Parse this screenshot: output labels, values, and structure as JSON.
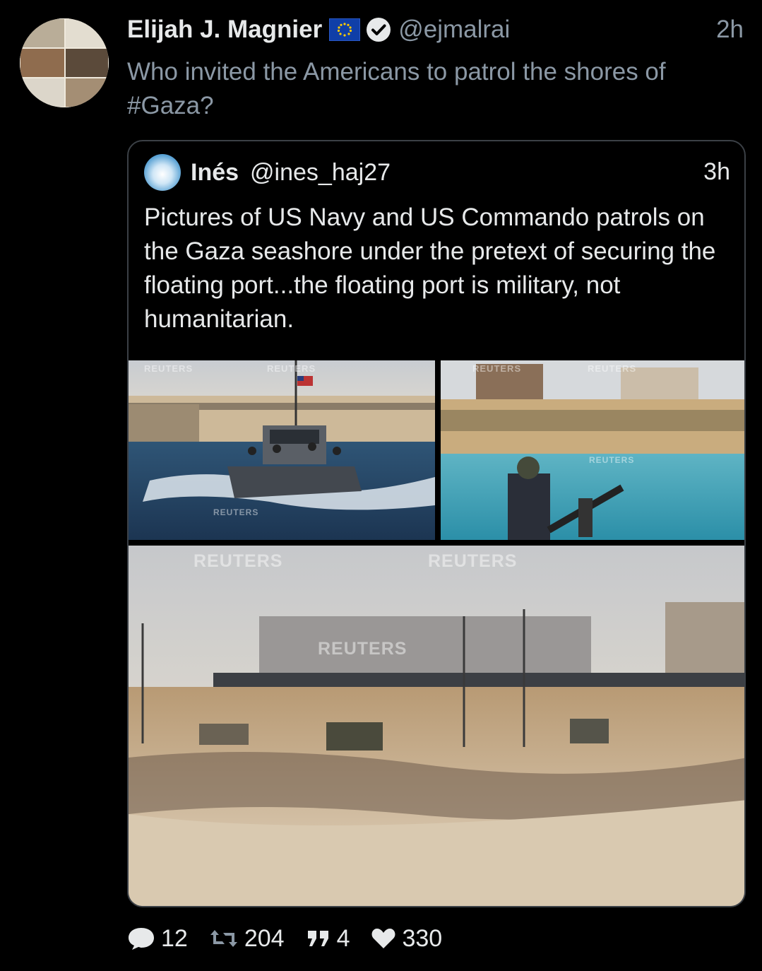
{
  "tweet": {
    "author_name": "Elijah J. Magnier",
    "handle": "@ejmalrai",
    "time": "2h",
    "text_plain": "Who invited the Americans to patrol the shores of ",
    "hashtag": "#Gaza",
    "text_end": "?"
  },
  "quote": {
    "author_name": "Inés",
    "handle": "@ines_haj27",
    "time": "3h",
    "text": "Pictures of US Navy and US Commando patrols on the Gaza seashore under the pretext of securing the floating port...the floating port is military, not humanitarian."
  },
  "photos": {
    "watermark": "REUTERS"
  },
  "actions": {
    "replies": "12",
    "retweets": "204",
    "quotes": "4",
    "likes": "330"
  },
  "colors": {
    "background": "#000000",
    "text_primary": "#e7e9ea",
    "text_secondary": "#8b98a5",
    "border": "#3b4046"
  }
}
